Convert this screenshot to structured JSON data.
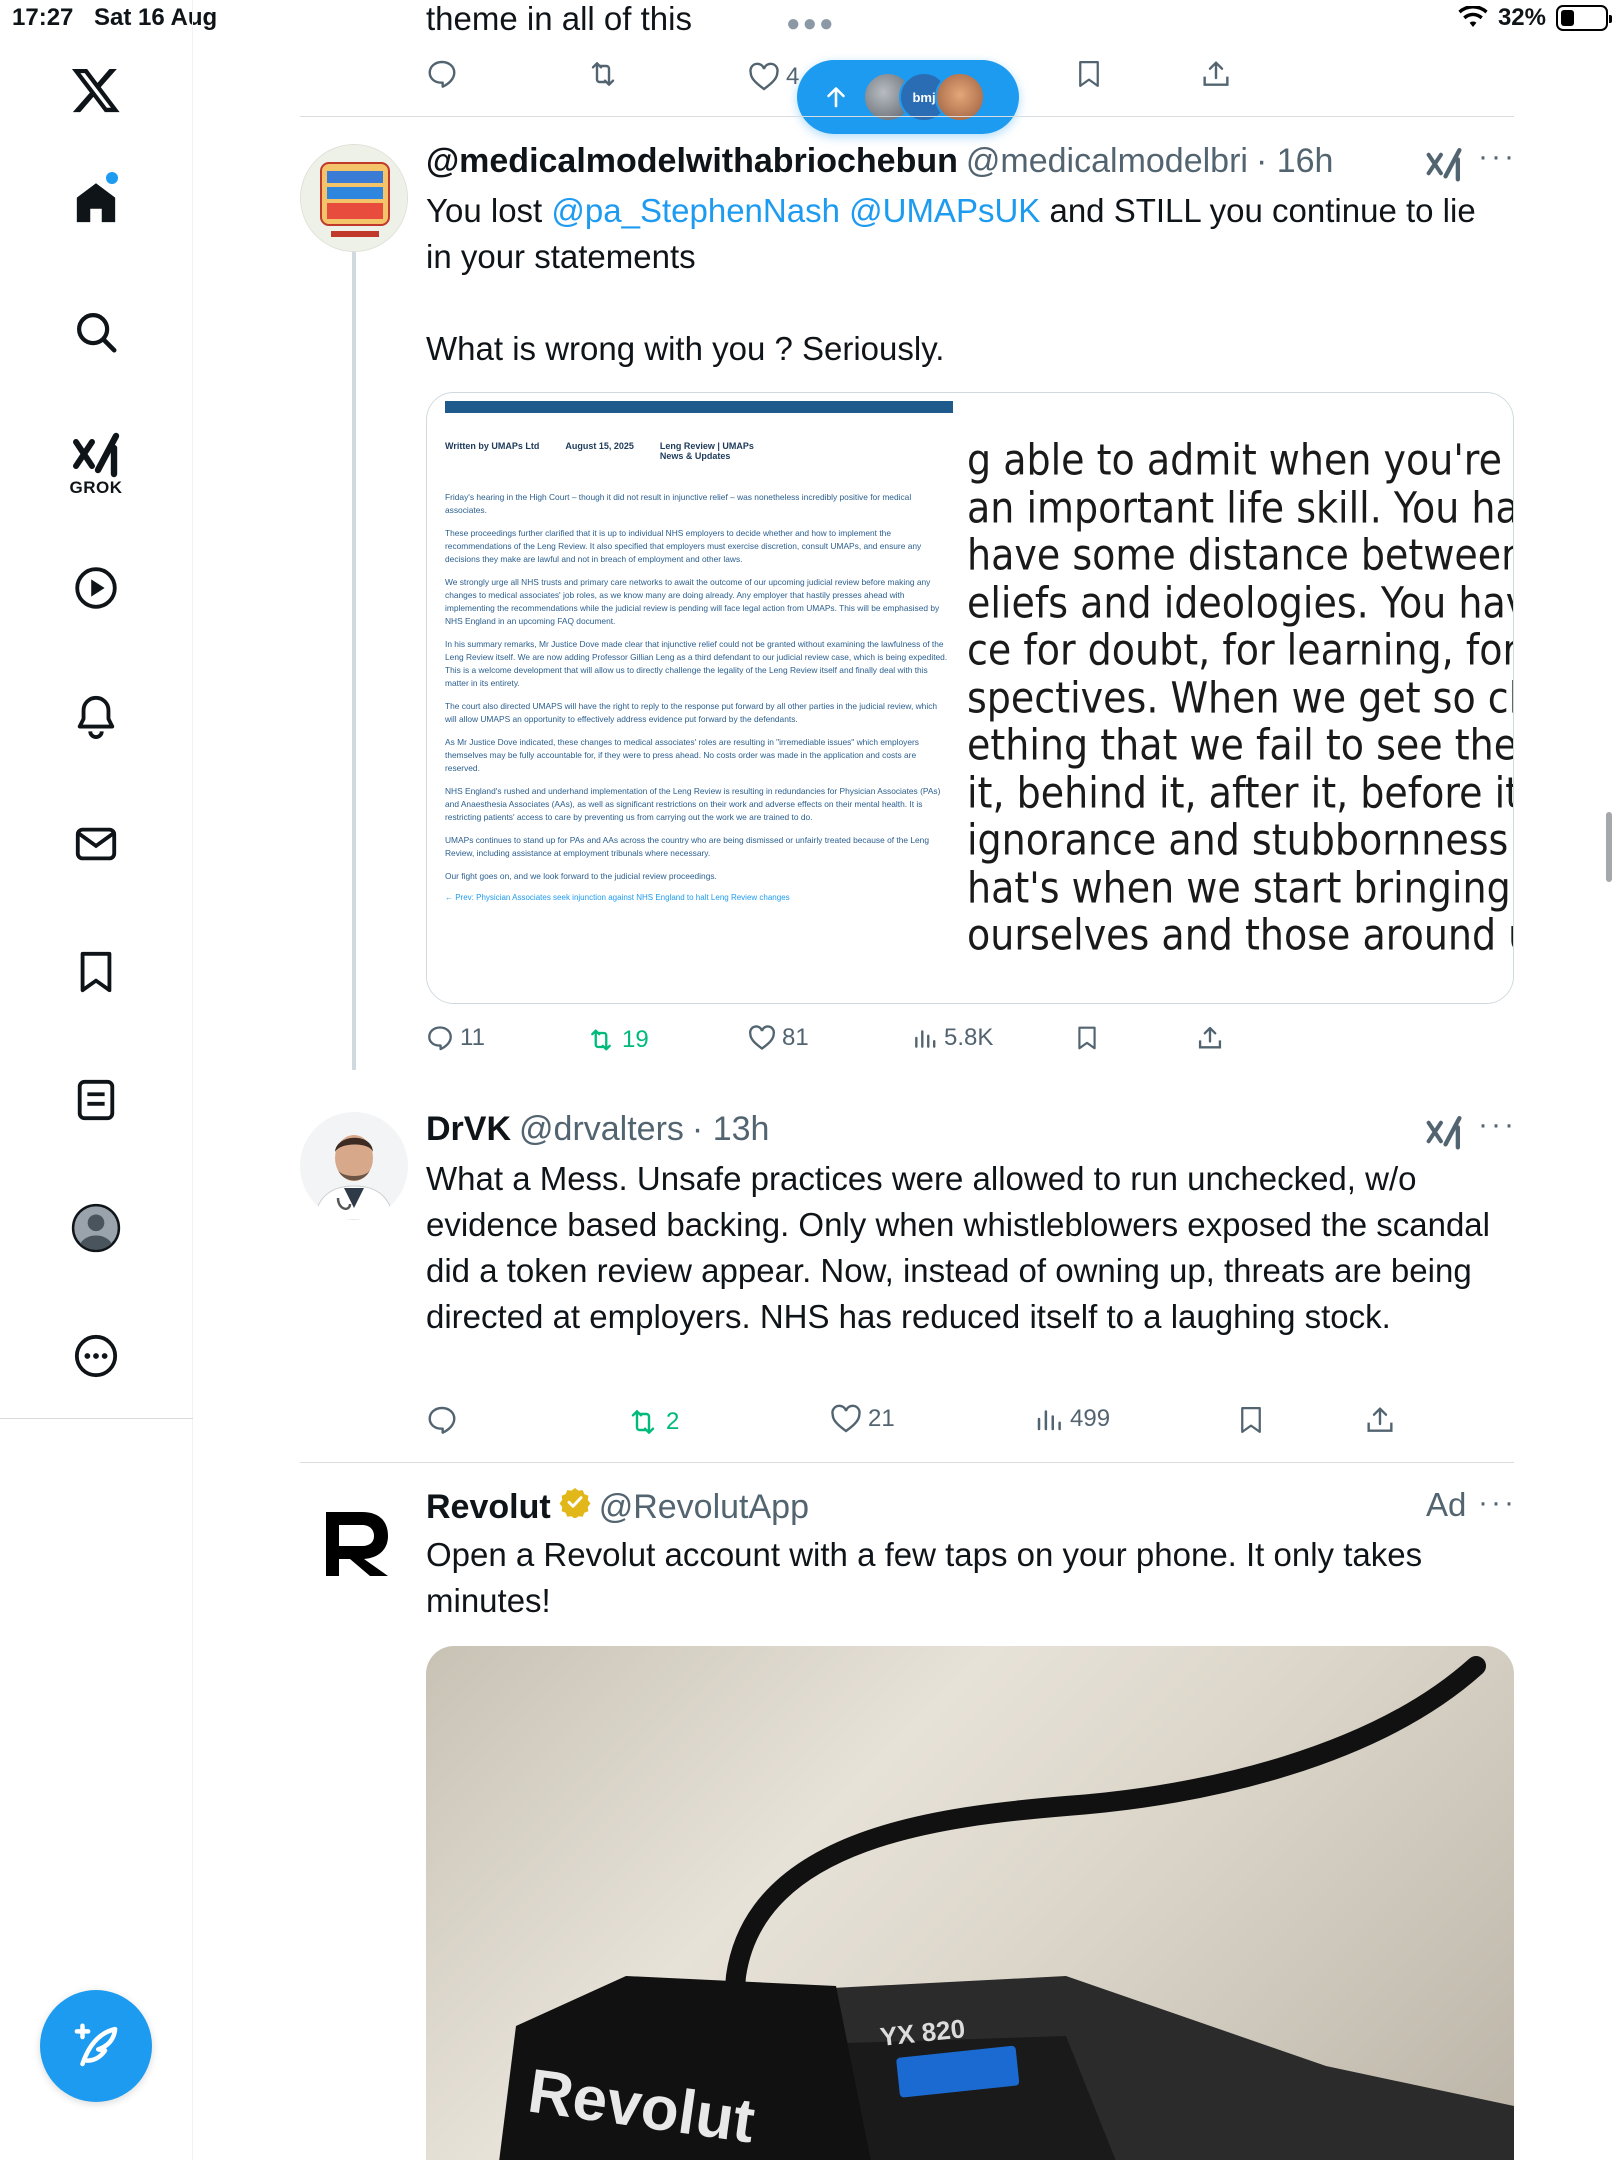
{
  "status_bar": {
    "time": "17:27",
    "date": "Sat 16 Aug",
    "battery": "32%",
    "battery_level": 0.32
  },
  "top": {
    "partial_text": "theme in all of this",
    "likes_partial": "4",
    "new_posts_pill": {
      "avatars": [
        "avatar-1",
        "bmj",
        "avatar-3"
      ]
    }
  },
  "sidebar": {
    "items": [
      {
        "name": "x-logo"
      },
      {
        "name": "home-icon"
      },
      {
        "name": "search-icon"
      },
      {
        "name": "grok-icon",
        "label": "GROK"
      },
      {
        "name": "video-icon"
      },
      {
        "name": "notifications-icon"
      },
      {
        "name": "messages-icon"
      },
      {
        "name": "bookmarks-icon"
      },
      {
        "name": "lists-icon"
      },
      {
        "name": "profile-icon"
      },
      {
        "name": "more-icon"
      }
    ]
  },
  "posts": [
    {
      "name": "@medicalmodelwithabriochebun",
      "handle": "@medicalmodelbri",
      "time": "· 16h",
      "body_1_prefix": "You lost ",
      "mention_1": "@pa_StephenNash",
      "mention_2": "@UMAPsUK",
      "body_1_suffix": " and STILL you continue to lie in your statements",
      "body_2": "What is wrong with you ? Seriously.",
      "replies": "11",
      "reposts": "19",
      "likes": "81",
      "views": "5.8K",
      "image_doc": {
        "written_by": "Written by UMAPs Ltd",
        "date": "August 15, 2025",
        "category": "Leng Review | UMAPs News & Updates",
        "paragraphs": [
          "Friday's hearing in the High Court – though it did not result in injunctive relief – was nonetheless incredibly positive for medical associates.",
          "These proceedings further clarified that it is up to individual NHS employers to decide whether and how to implement the recommendations of the Leng Review. It also specified that employers must exercise discretion, consult UMAPs, and ensure any decisions they make are lawful and not in breach of employment and other laws.",
          "We strongly urge all NHS trusts and primary care networks to await the outcome of our upcoming judicial review before making any changes to medical associates' job roles, as we know many are doing already. Any employer that hastily presses ahead with implementing the recommendations while the judicial review is pending will face legal action from UMAPs. This will be emphasised by NHS England in an upcoming FAQ document.",
          "In his summary remarks, Mr Justice Dove made clear that injunctive relief could not be granted without examining the lawfulness of the Leng Review itself. We are now adding Professor Gillian Leng as a third defendant to our judicial review case, which is being expedited. This is a welcome development that will allow us to directly challenge the legality of the Leng Review itself and finally deal with this matter in its entirety.",
          "The court also directed UMAPS will have the right to reply to the response put forward by all other parties in the judicial review, which will allow UMAPS an opportunity to effectively address evidence put forward by the defendants.",
          "As Mr Justice Dove indicated, these changes to medical associates' roles are resulting in \"irremediable issues\" which employers themselves may be fully accountable for, if they were to press ahead. No costs order was made in the application and costs are reserved.",
          "NHS England's rushed and underhand implementation of the Leng Review is resulting in redundancies for Physician Associates (PAs) and Anaesthesia Associates (AAs), as well as significant restrictions on their work and adverse effects on their mental health. It is restricting patients' access to care by preventing us from carrying out the work we are trained to do.",
          "UMAPs continues to stand up for PAs and AAs across the country who are being dismissed or unfairly treated because of the Leng Review, including assistance at employment tribunals where necessary.",
          "Our fight goes on, and we look forward to the judicial review proceedings."
        ],
        "footer_link": "← Prev: Physician Associates seek injunction against NHS England to halt Leng Review changes"
      },
      "image_quote_lines": [
        "g able to admit when you're wro",
        " an important life skill. You hav",
        "have some distance between yo",
        "eliefs and ideologies. You have b",
        "ce for doubt, for learning, for n",
        "spectives. When we get so close",
        "ething that we fail to see the th",
        " it, behind it, after it, before it.",
        " ignorance and stubbornness cr",
        "hat's when we start bringing pa",
        "ourselves and those around us.'"
      ]
    },
    {
      "name": "DrVK",
      "handle": "@drvalters",
      "time": "· 13h",
      "body": "What a Mess. Unsafe practices were allowed to run unchecked, w/o evidence based backing. Only when whistleblowers exposed the scandal did a token review appear. Now, instead of owning up, threats are being directed at employers. NHS has reduced itself to a laughing stock.",
      "replies": "",
      "reposts": "2",
      "likes": "21",
      "views": "499"
    },
    {
      "name": "Revolut",
      "handle": "@RevolutApp",
      "ad_label": "Ad",
      "body": "Open a Revolut account with a few taps on your phone. It only takes minutes!",
      "image_card_text": "Revolut",
      "image_device_text": "YX 820"
    }
  ],
  "colors": {
    "accent": "#1d9bf0",
    "repost_green": "#00ba7c",
    "secondary_text": "#536471"
  }
}
